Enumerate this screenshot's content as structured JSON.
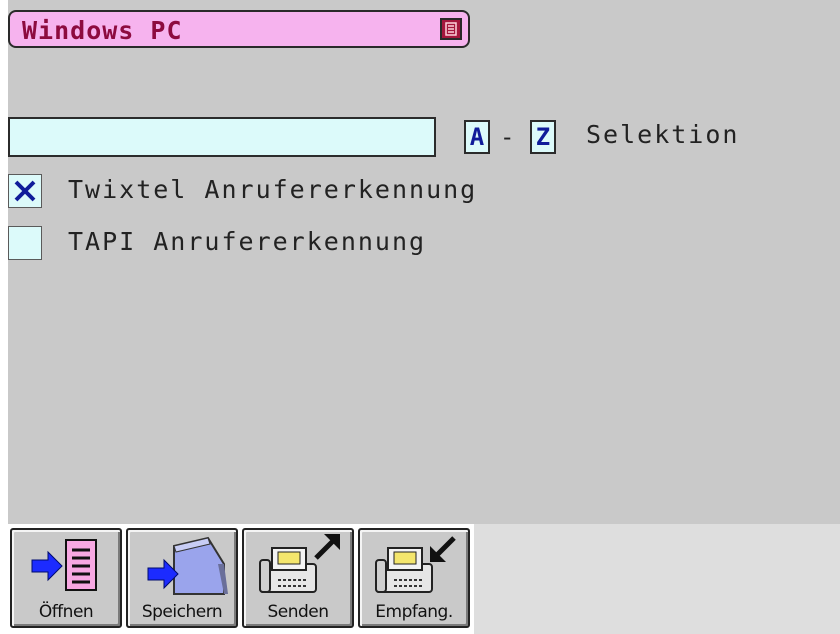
{
  "window": {
    "title": "Windows PC"
  },
  "selection": {
    "input_value": "",
    "range_start": "A",
    "range_separator": "-",
    "range_end": "Z",
    "label": "Selektion"
  },
  "options": [
    {
      "label": "Twixtel Anrufererkennung",
      "checked": true,
      "check_mark": "✕"
    },
    {
      "label": "TAPI Anrufererkennung",
      "checked": false,
      "check_mark": ""
    }
  ],
  "toolbar": {
    "buttons": [
      {
        "label": "Öffnen",
        "icon": "open-document-icon"
      },
      {
        "label": "Speichern",
        "icon": "save-folder-icon"
      },
      {
        "label": "Senden",
        "icon": "send-fax-icon"
      },
      {
        "label": "Empfang.",
        "icon": "receive-fax-icon"
      }
    ]
  },
  "colors": {
    "panel_bg": "#c9c9c9",
    "title_bg": "#f6b3ee",
    "title_text": "#8d0b3f",
    "field_bg": "#dcfafa",
    "accent_blue": "#101c9a"
  }
}
